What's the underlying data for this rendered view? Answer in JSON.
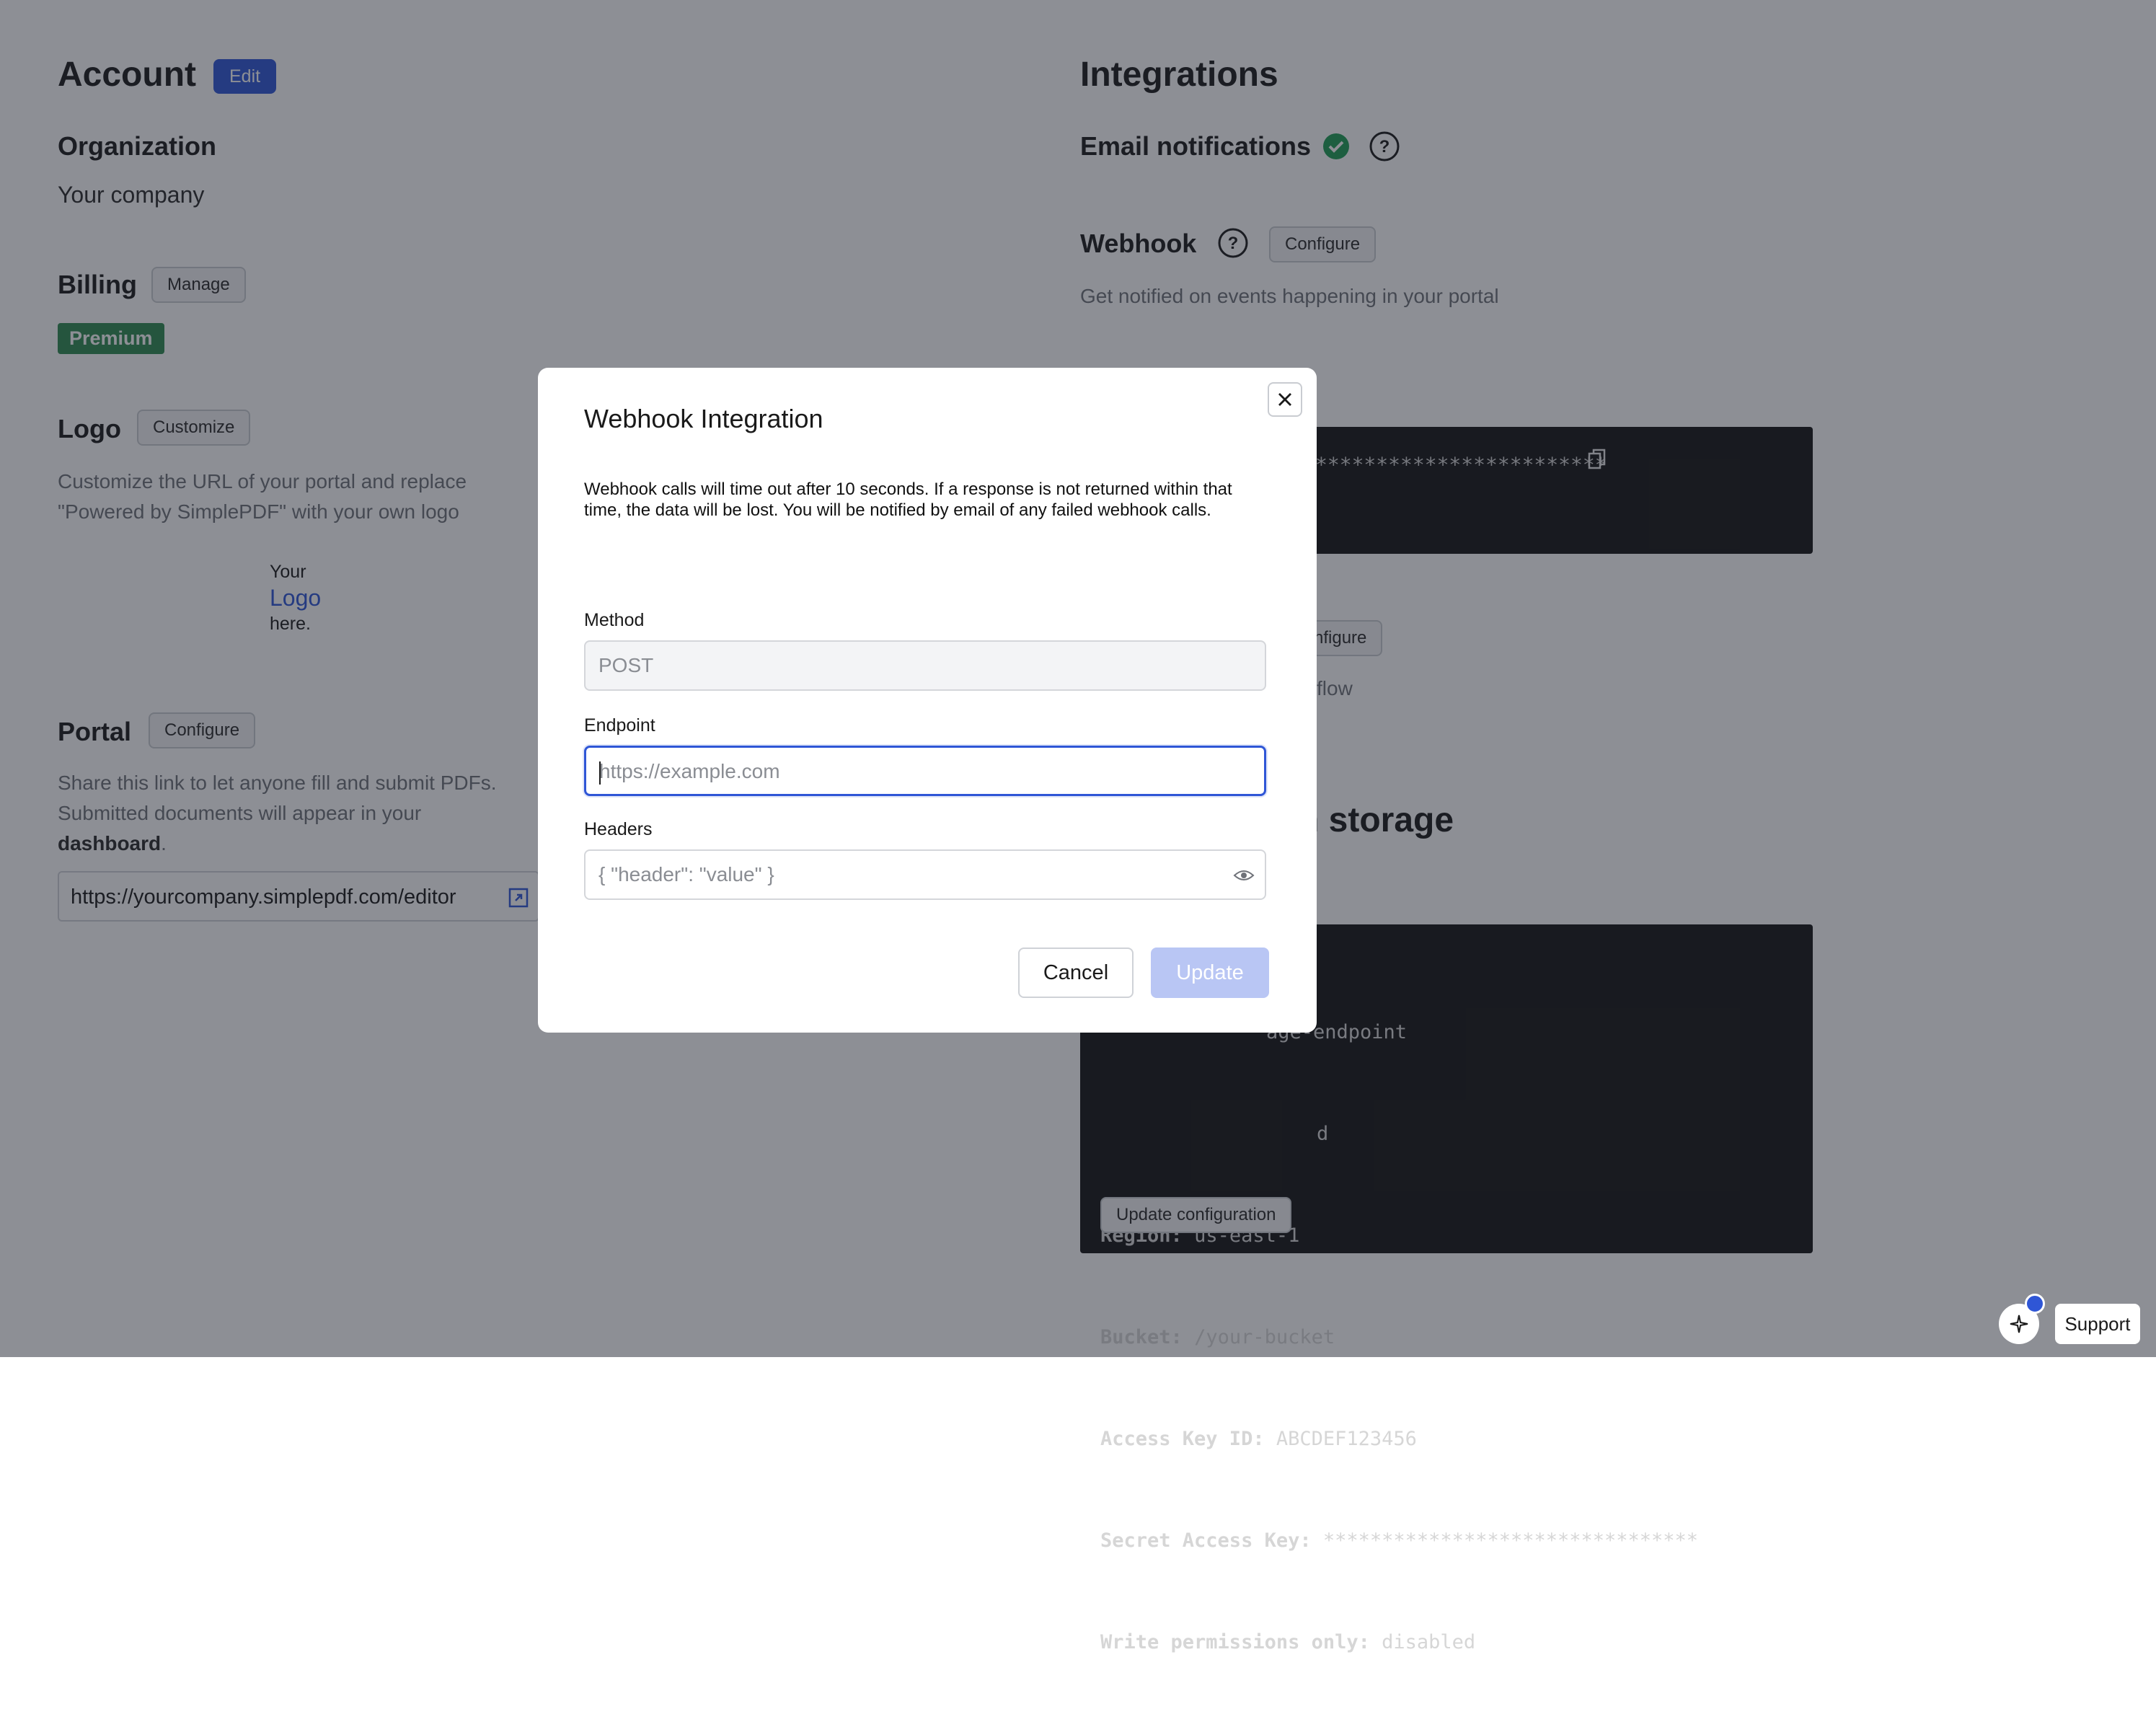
{
  "account": {
    "title": "Account",
    "edit_label": "Edit",
    "organization_heading": "Organization",
    "organization_value": "Your company",
    "billing_heading": "Billing",
    "billing_manage": "Manage",
    "billing_plan": "Premium",
    "logo_heading": "Logo",
    "logo_customize": "Customize",
    "logo_desc_line1": "Customize the URL of your portal and replace",
    "logo_desc_line2": "\"Powered by SimplePDF\" with your own logo",
    "logo_placeholder": [
      "Your",
      "Logo",
      "here."
    ],
    "portal_heading": "Portal",
    "portal_configure": "Configure",
    "portal_desc_line1": "Share this link to let anyone fill and submit PDFs.",
    "portal_desc_line2": "Submitted documents will appear in your",
    "portal_desc_bold": "dashboard",
    "portal_desc_end": ".",
    "portal_url": "https://yourcompany.simplepdf.com/editor"
  },
  "integrations": {
    "title": "Integrations",
    "email_heading": "Email notifications",
    "webhook_heading": "Webhook",
    "webhook_configure": "Configure",
    "webhook_desc": "Get notified on events happening in your portal",
    "webhook_secret_masked": "************************",
    "second_configure_partial": "nfigure",
    "second_desc_partial": "flow",
    "storage_heading_partial": "n storage",
    "storage_lines": [
      {
        "key": "",
        "value": "age-endpoint"
      },
      {
        "key": "",
        "value": "d"
      },
      {
        "key": "Region:",
        "value": "us-east-1"
      },
      {
        "key": "Bucket:",
        "value": "/your-bucket"
      },
      {
        "key": "Access Key ID:",
        "value": "ABCDEF123456"
      },
      {
        "key": "Secret Access Key:",
        "value": "********************************"
      },
      {
        "key": "Write permissions only:",
        "value": "disabled"
      }
    ],
    "update_configuration": "Update configuration"
  },
  "modal": {
    "title": "Webhook Integration",
    "description": "Webhook calls will time out after 10 seconds. If a response is not returned within that time, the data will be lost. You will be notified by email of any failed webhook calls.",
    "method_label": "Method",
    "method_value": "POST",
    "endpoint_label": "Endpoint",
    "endpoint_placeholder": "https://example.com",
    "headers_label": "Headers",
    "headers_placeholder": "{ \"header\": \"value\" }",
    "cancel_label": "Cancel",
    "update_label": "Update"
  },
  "support": {
    "label": "Support"
  },
  "colors": {
    "accent": "#2f56d6",
    "premium": "#2e8a50",
    "success": "#1f9d55",
    "overlay": "rgba(28,32,43,0.50)"
  },
  "icons": [
    "check-circle-icon",
    "help-icon",
    "copy-icon",
    "external-link-icon",
    "close-icon",
    "eye-icon",
    "sparkle-icon"
  ]
}
